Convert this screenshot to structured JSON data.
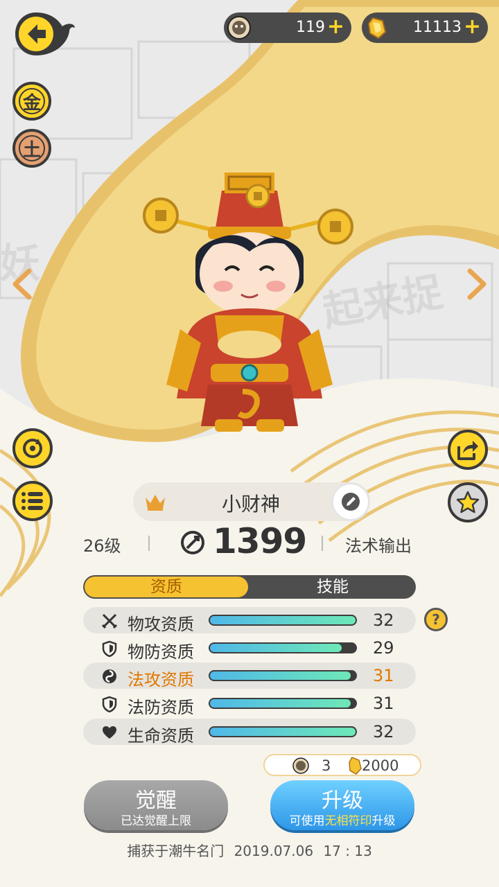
{
  "currency": {
    "coin_value": "119",
    "gem_value": "11113",
    "plus": "+"
  },
  "badges": {
    "gold": "金",
    "earth": "土"
  },
  "pet": {
    "name": "小财神",
    "level": "26级",
    "power": "1399",
    "role": "法术输出"
  },
  "tabs": {
    "aptitude": "资质",
    "skills": "技能"
  },
  "attributes": [
    {
      "label": "物攻资质",
      "value": "32",
      "fill": 1.0,
      "icon": "crossed-swords-icon"
    },
    {
      "label": "物防资质",
      "value": "29",
      "fill": 0.906,
      "icon": "shield-icon"
    },
    {
      "label": "法攻资质",
      "value": "31",
      "fill": 0.969,
      "icon": "swirl-magic-icon",
      "highlight": true
    },
    {
      "label": "法防资质",
      "value": "31",
      "fill": 0.969,
      "icon": "shield-icon"
    },
    {
      "label": "生命资质",
      "value": "32",
      "fill": 1.0,
      "icon": "heart-icon"
    }
  ],
  "help": "?",
  "cost": {
    "coin": "3",
    "gem": "2000"
  },
  "awaken": {
    "title": "觉醒",
    "subtitle": "已达觉醒上限"
  },
  "upgrade": {
    "title": "升级",
    "sub_prefix": "可使用",
    "sub_highlight": "无相符印",
    "sub_suffix": "升级"
  },
  "footer": {
    "caught": "捕获于潮牛名门",
    "date": "2019.07.06",
    "time": "17 : 13"
  },
  "colors": {
    "accent_yellow": "#ffd52a",
    "bar_start": "#4fb8e8",
    "bar_end": "#6ee8b8",
    "highlight": "#e07800",
    "upgrade_blue": "#2d96e8"
  }
}
